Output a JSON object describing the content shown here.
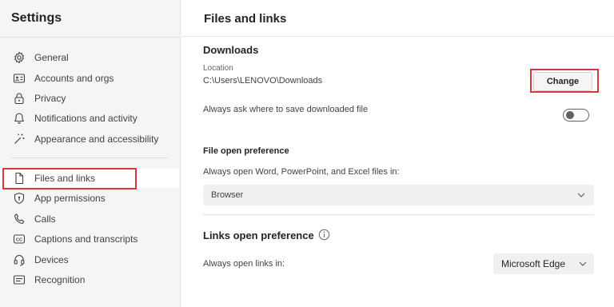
{
  "sidebar": {
    "title": "Settings",
    "items": [
      {
        "label": "General",
        "icon": "gear-icon"
      },
      {
        "label": "Accounts and orgs",
        "icon": "id-card-icon"
      },
      {
        "label": "Privacy",
        "icon": "lock-icon"
      },
      {
        "label": "Notifications and activity",
        "icon": "bell-icon"
      },
      {
        "label": "Appearance and accessibility",
        "icon": "magic-wand-icon"
      },
      {
        "label": "Files and links",
        "icon": "document-icon"
      },
      {
        "label": "App permissions",
        "icon": "shield-icon"
      },
      {
        "label": "Calls",
        "icon": "phone-icon"
      },
      {
        "label": "Captions and transcripts",
        "icon": "closed-captions-icon"
      },
      {
        "label": "Devices",
        "icon": "headset-icon"
      },
      {
        "label": "Recognition",
        "icon": "recognition-icon"
      }
    ],
    "selected": "Files and links"
  },
  "main": {
    "title": "Files and links",
    "downloads": {
      "title": "Downloads",
      "location_label": "Location",
      "location_value": "C:\\Users\\LENOVO\\Downloads",
      "change_label": "Change",
      "ask_label": "Always ask where to save downloaded file",
      "ask_enabled": false
    },
    "file_open": {
      "title": "File open preference",
      "description": "Always open Word, PowerPoint, and Excel files in:",
      "selected": "Browser"
    },
    "links_open": {
      "title": "Links open preference",
      "description": "Always open links in:",
      "selected": "Microsoft Edge"
    }
  },
  "colors": {
    "highlight": "#d9363e",
    "sidebar_bg": "#f5f5f5"
  }
}
